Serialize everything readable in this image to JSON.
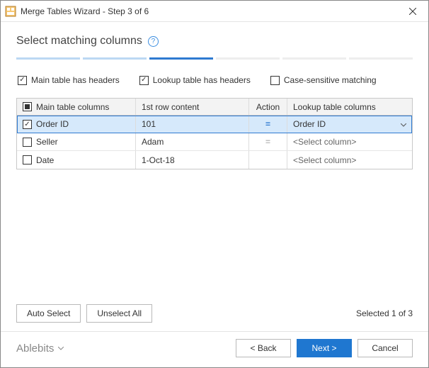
{
  "titlebar": {
    "title": "Merge Tables Wizard - Step 3 of 6"
  },
  "heading": "Select matching columns",
  "progress": {
    "total": 6,
    "current": 3
  },
  "options": {
    "main_has_headers": {
      "label": "Main table has headers",
      "checked": true
    },
    "lookup_has_headers": {
      "label": "Lookup table has headers",
      "checked": true
    },
    "case_sensitive": {
      "label": "Case-sensitive matching",
      "checked": false
    }
  },
  "grid": {
    "headers": {
      "main": "Main table columns",
      "first": "1st row content",
      "action": "Action",
      "lookup": "Lookup table columns"
    },
    "rows": [
      {
        "checked": true,
        "main": "Order ID",
        "first": "101",
        "action": "=",
        "lookup": "Order ID",
        "selected": true,
        "lookup_placeholder": false
      },
      {
        "checked": false,
        "main": "Seller",
        "first": "Adam",
        "action": "=",
        "lookup": "<Select column>",
        "selected": false,
        "lookup_placeholder": true
      },
      {
        "checked": false,
        "main": "Date",
        "first": "1-Oct-18",
        "action": "",
        "lookup": "<Select column>",
        "selected": false,
        "lookup_placeholder": true
      }
    ]
  },
  "buttons": {
    "auto_select": "Auto Select",
    "unselect_all": "Unselect All",
    "back": "< Back",
    "next": "Next >",
    "cancel": "Cancel"
  },
  "status": {
    "selected_text": "Selected 1 of 3"
  },
  "brand": "Ablebits"
}
